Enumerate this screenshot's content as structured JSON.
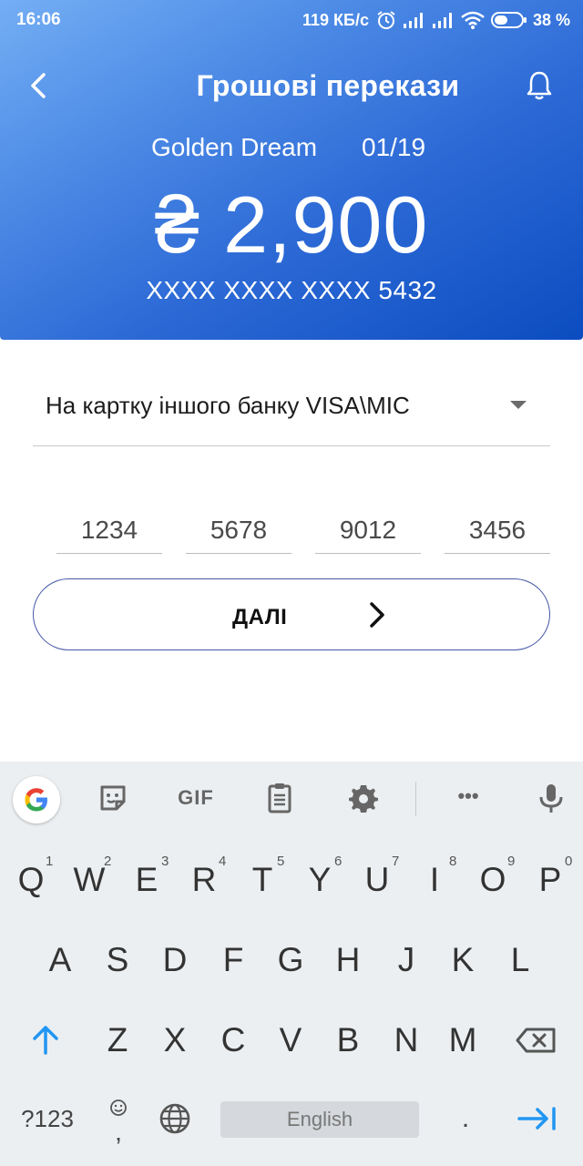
{
  "status_bar": {
    "time": "16:06",
    "speed": "119 КБ/с",
    "battery": "38 %"
  },
  "header": {
    "title": "Грошові перекази",
    "card_name": "Golden Dream",
    "card_date": "01/19",
    "balance": "₴ 2,900",
    "card_number": "XXXX XXXX XXXX 5432",
    "gradient_colors": [
      "#74aef4",
      "#0b4cc0"
    ]
  },
  "form": {
    "transfer_type": "На картку іншого банку VISA\\MIC",
    "card_fields": [
      "1234",
      "5678",
      "9012",
      "3456"
    ],
    "next_label": "ДАЛІ",
    "accent": "#4457a8"
  },
  "keyboard": {
    "toolbar": [
      "google-icon",
      "sticker-icon",
      "gif-icon",
      "clipboard-icon",
      "settings-icon",
      "more-icon",
      "microphone-icon"
    ],
    "gif_label": "GIF",
    "more_label": "•••",
    "row1": [
      {
        "key": "Q",
        "hint": "1"
      },
      {
        "key": "W",
        "hint": "2"
      },
      {
        "key": "E",
        "hint": "3"
      },
      {
        "key": "R",
        "hint": "4"
      },
      {
        "key": "T",
        "hint": "5"
      },
      {
        "key": "Y",
        "hint": "6"
      },
      {
        "key": "U",
        "hint": "7"
      },
      {
        "key": "I",
        "hint": "8"
      },
      {
        "key": "O",
        "hint": "9"
      },
      {
        "key": "P",
        "hint": "0"
      }
    ],
    "row2": [
      "A",
      "S",
      "D",
      "F",
      "G",
      "H",
      "J",
      "K",
      "L"
    ],
    "row3": [
      "Z",
      "X",
      "C",
      "V",
      "B",
      "N",
      "M"
    ],
    "symbols_label": "?123",
    "comma_label": ",",
    "space_label": "English",
    "period_label": ".",
    "enter_color": "#2196f3"
  }
}
